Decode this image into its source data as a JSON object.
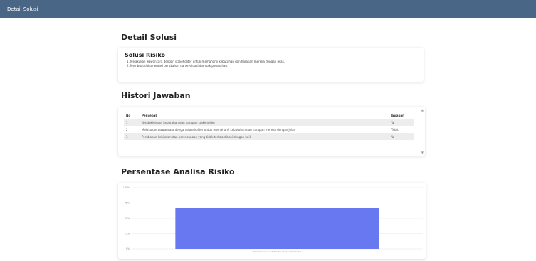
{
  "topbar": {
    "title": "Detail Solusi"
  },
  "page": {
    "heading": "Detail Solusi"
  },
  "solusi": {
    "title": "Solusi Risiko",
    "items": [
      "Melakukan wawancara dengan stakeholder untuk memahami kebutuhan dan harapan mereka dengan jelas.",
      "Membuat dokumentasi perubahan dan evaluasi dampak perubahan."
    ]
  },
  "histori": {
    "heading": "Histori Jawaban",
    "columns": {
      "no": "No",
      "penyebab": "Penyebab",
      "jawaban": "Jawaban"
    },
    "rows": [
      {
        "no": "1",
        "penyebab": "Ketidakjelasan kebutuhan dan harapan stakeholder",
        "jawaban": "Ya"
      },
      {
        "no": "2",
        "penyebab": "Melakukan wawancara dengan stakeholder untuk memahami kebutuhan dan harapan mereka dengan jelas",
        "jawaban": "Tidak"
      },
      {
        "no": "3",
        "penyebab": "Perubahan kebijakan dan perencanaan yang tidak terkoordinasi dengan baik",
        "jawaban": "Ya"
      }
    ]
  },
  "persentase": {
    "heading": "Persentase Analisa Risiko"
  },
  "chart_data": {
    "type": "bar",
    "categories": [
      "Ketidakjelasan kebutuhan dan harapan stakeholder"
    ],
    "values": [
      67
    ],
    "ylim": [
      0,
      100
    ],
    "yticks": [
      "0%",
      "25%",
      "50%",
      "75%",
      "100%"
    ],
    "bar_color": "#6878f0",
    "grid": true
  }
}
